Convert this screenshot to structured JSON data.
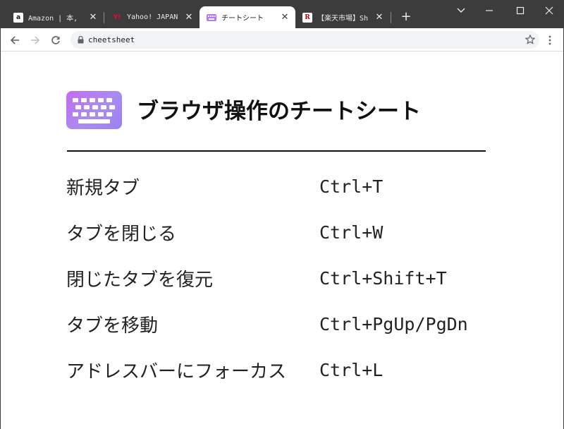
{
  "browser": {
    "tabs": [
      {
        "title": "Amazon | 本, ",
        "favicon": "amazon-icon",
        "active": false
      },
      {
        "title": "Yahoo! JAPAN",
        "favicon": "yahoo-icon",
        "active": false
      },
      {
        "title": "チートシート",
        "favicon": "keyboard-icon",
        "active": true
      },
      {
        "title": "【楽天市場】Sh",
        "favicon": "rakuten-icon",
        "active": false
      }
    ],
    "address": "cheetsheet",
    "colors": {
      "frame": "#3c3c3c",
      "toolbar": "#ffffff",
      "omnibox": "#f1f3f4"
    }
  },
  "page": {
    "title": "ブラウザ操作のチートシート",
    "icon": "keyboard-icon",
    "accent": "#b57cf0",
    "shortcuts": [
      {
        "action": "新規タブ",
        "keys": "Ctrl+T"
      },
      {
        "action": "タブを閉じる",
        "keys": "Ctrl+W"
      },
      {
        "action": "閉じたタブを復元",
        "keys": "Ctrl+Shift+T"
      },
      {
        "action": "タブを移動",
        "keys": "Ctrl+PgUp/PgDn"
      },
      {
        "action": "アドレスバーにフォーカス",
        "keys": "Ctrl+L"
      }
    ]
  }
}
